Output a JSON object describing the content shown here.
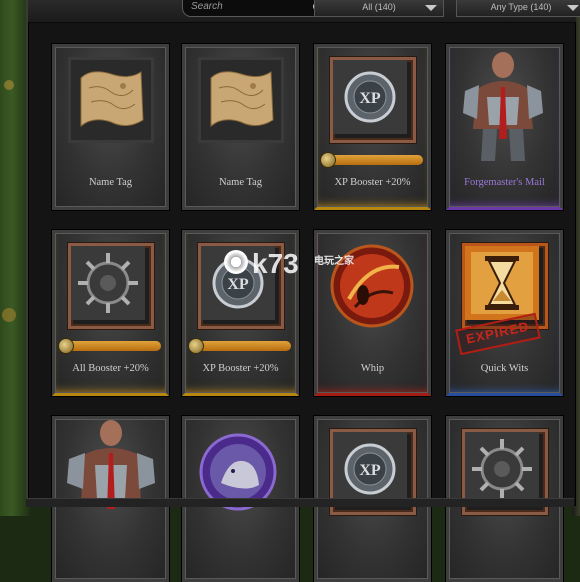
{
  "toolbar": {
    "search_placeholder": "Search",
    "filter_all": "All (140)",
    "filter_type": "Any Type (140)"
  },
  "items": [
    {
      "label": "Name Tag",
      "icon": "scroll-map-icon",
      "rarity": "common"
    },
    {
      "label": "Name Tag",
      "icon": "scroll-map-icon",
      "rarity": "common"
    },
    {
      "label": "XP Booster +20%",
      "icon": "xp-booster-icon",
      "rarity": "gold",
      "progress": 1.0
    },
    {
      "label": "Forgemaster's Mail",
      "icon": "armored-warrior-icon",
      "rarity": "purple"
    },
    {
      "label": "All Booster +20%",
      "icon": "all-booster-icon",
      "rarity": "gold",
      "progress": 1.0
    },
    {
      "label": "XP Booster +20%",
      "icon": "xp-booster-icon",
      "rarity": "gold",
      "progress": 1.0
    },
    {
      "label": "Whip",
      "icon": "whip-icon",
      "rarity": "red"
    },
    {
      "label": "Quick Wits",
      "icon": "hourglass-icon",
      "rarity": "blue",
      "stamp": "EXPIRED"
    },
    {
      "label": "",
      "icon": "armored-warrior-icon",
      "rarity": "common"
    },
    {
      "label": "",
      "icon": "werewolf-portrait-icon",
      "rarity": "common"
    },
    {
      "label": "",
      "icon": "xp-booster-icon",
      "rarity": "common"
    },
    {
      "label": "",
      "icon": "all-booster-icon",
      "rarity": "common"
    }
  ],
  "watermark": {
    "main": "k73",
    "sub": "电玩之家"
  },
  "colors": {
    "gold": "#b8870f",
    "purple": "#6b3aa8",
    "red": "#a51c12",
    "blue": "#274d9c",
    "expired": "#c8261a"
  }
}
